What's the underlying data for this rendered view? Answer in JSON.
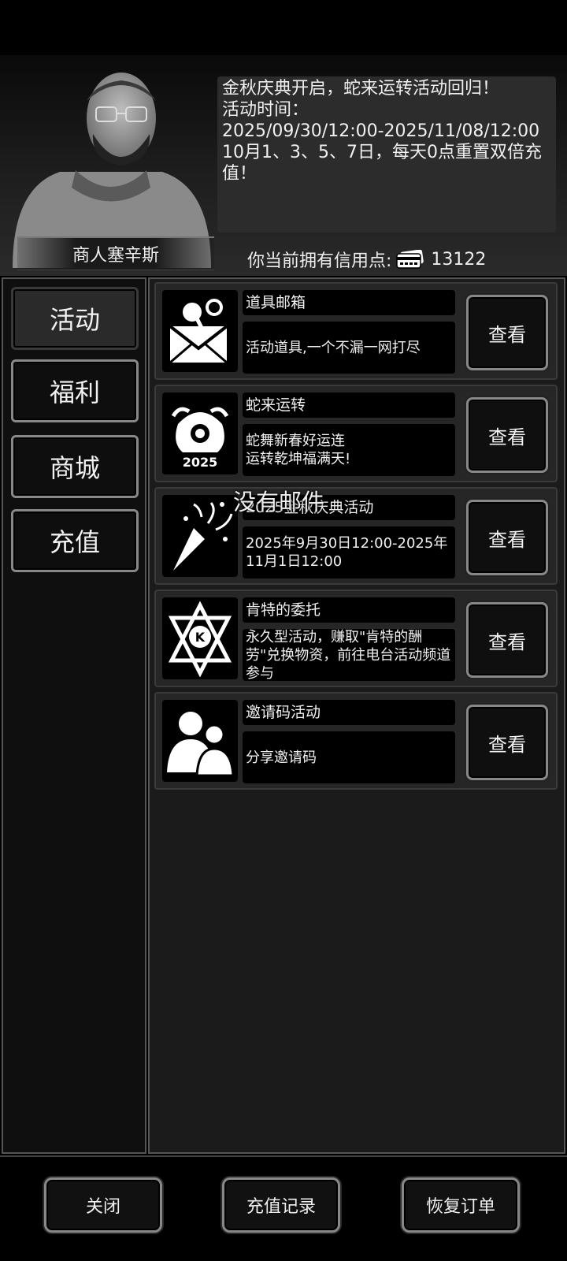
{
  "npc": {
    "name": "商人塞辛斯"
  },
  "announcement": {
    "lines": [
      "金秋庆典开启，蛇来运转活动回归！",
      "活动时间：",
      "2025/09/30/12:00-2025/11/08/12:00",
      "10月1、3、5、7日，每天0点重置双倍充值！"
    ]
  },
  "credits": {
    "label": "你当前拥有信用点:",
    "icon": "credit-card-icon",
    "value": "13122"
  },
  "tabs": [
    {
      "label": "活动",
      "active": true
    },
    {
      "label": "福利",
      "active": false
    },
    {
      "label": "商城",
      "active": false
    },
    {
      "label": "充值",
      "active": false
    }
  ],
  "activities": [
    {
      "title": "道具邮箱",
      "desc": "活动道具,一个不漏一网打尽",
      "icon": "mail-pin-icon",
      "button": "查看"
    },
    {
      "title": "蛇来运转",
      "desc": "蛇舞新春好运连\n运转乾坤福满天!",
      "icon": "snake-2025-icon",
      "icon_text": "2025",
      "button": "查看"
    },
    {
      "title": "2025金秋庆典活动",
      "desc": "2025年9月30日12:00-2025年11月1日12:00",
      "icon": "party-popper-icon",
      "button": "查看"
    },
    {
      "title": "肯特的委托",
      "desc": "永久型活动，赚取\"肯特的酬劳\"兑换物资，前往电台活动频道参与",
      "icon": "kent-emblem-icon",
      "icon_text": "K",
      "button": "查看"
    },
    {
      "title": "邀请码活动",
      "desc": "分享邀请码",
      "icon": "users-icon",
      "button": "查看"
    }
  ],
  "toast": "没有邮件",
  "footer": {
    "close": "关闭",
    "recharge_history": "充值记录",
    "restore_order": "恢复订单"
  }
}
